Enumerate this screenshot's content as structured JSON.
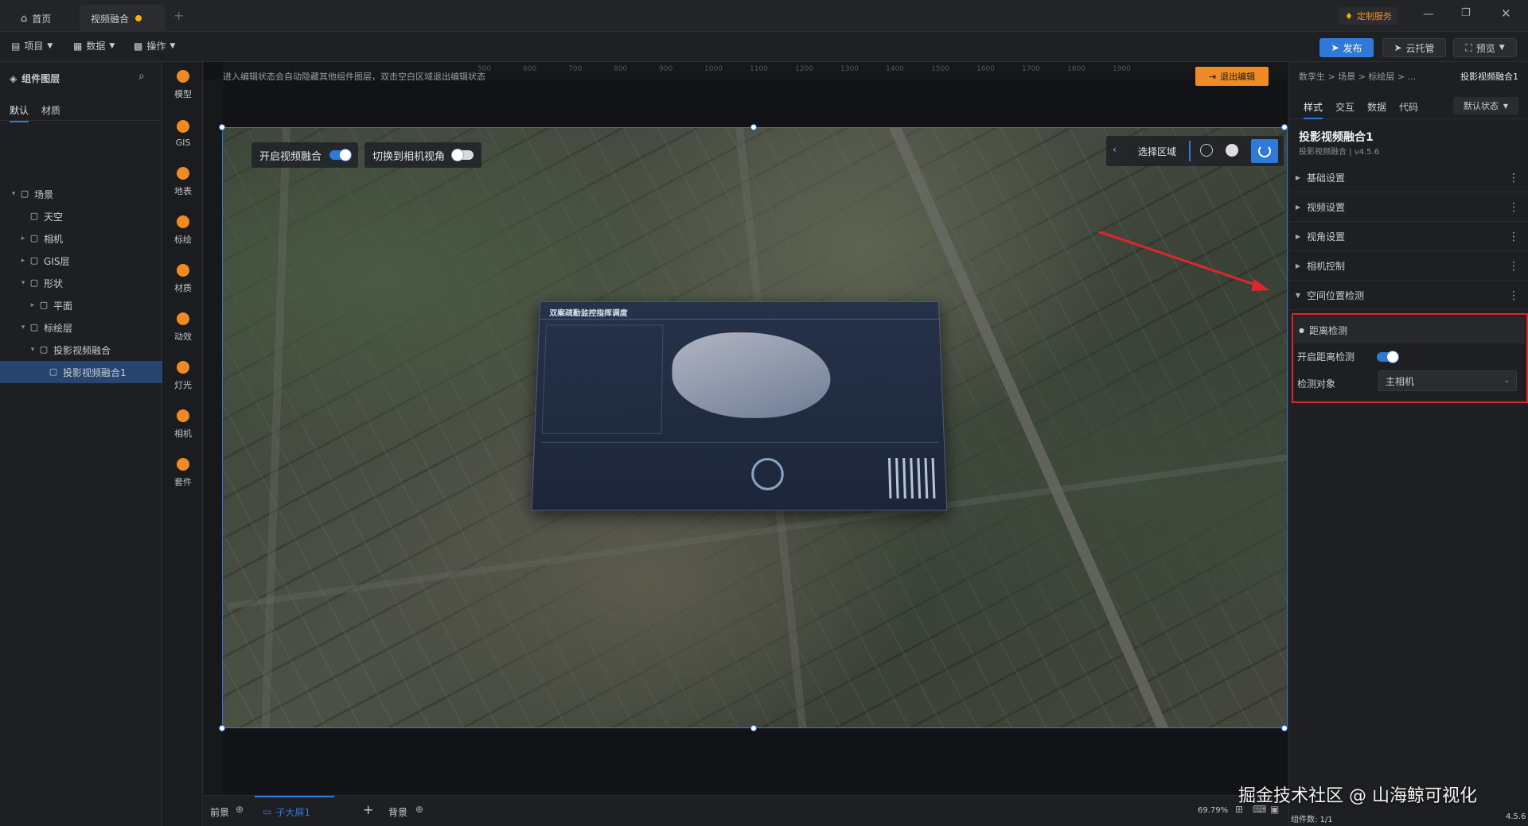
{
  "titlebar": {
    "home_tab": "首页",
    "active_tab": "视频融合",
    "service_badge": "定制服务"
  },
  "menubar": {
    "project": "项目",
    "data": "数据",
    "operate": "操作",
    "publish": "发布",
    "cloud": "云托管",
    "preview": "预览"
  },
  "left": {
    "title": "组件图层",
    "tabs": [
      "默认",
      "材质"
    ],
    "tree": [
      {
        "label": "场景",
        "icon": "scene-icon",
        "depth": 0,
        "expanded": true
      },
      {
        "label": "天空",
        "icon": "sky-icon",
        "depth": 1
      },
      {
        "label": "相机",
        "icon": "folder-icon",
        "depth": 1,
        "collapsed": true
      },
      {
        "label": "GIS层",
        "icon": "gis-icon",
        "depth": 1,
        "collapsed": true
      },
      {
        "label": "形状",
        "icon": "folder-icon",
        "depth": 1,
        "expanded": true
      },
      {
        "label": "平面",
        "icon": "plane-icon",
        "depth": 2,
        "collapsed": true
      },
      {
        "label": "标绘层",
        "icon": "folder-icon",
        "depth": 1,
        "expanded": true
      },
      {
        "label": "投影视频融合",
        "icon": "group-icon",
        "depth": 2,
        "expanded": true
      },
      {
        "label": "投影视频融合1",
        "icon": "group-icon",
        "depth": 3,
        "selected": true
      }
    ]
  },
  "tools": [
    "模型",
    "GIS",
    "地表",
    "标绘",
    "材质",
    "动效",
    "灯光",
    "相机",
    "套件"
  ],
  "canvas": {
    "hint": "进入编辑状态会自动隐藏其他组件图层，双击空白区域退出编辑状态",
    "exit_edit": "退出编辑",
    "toggle_video": "开启视频融合",
    "toggle_camera": "切换到相机视角",
    "select_area": "选择区域",
    "ruler_ticks": [
      "500",
      "600",
      "700",
      "800",
      "900",
      "1000",
      "1100",
      "1200",
      "1300",
      "1400",
      "1500",
      "1600",
      "1700",
      "1800",
      "1900"
    ],
    "dashboard_title": "双案疏勤监控指挥调度"
  },
  "right": {
    "breadcrumb": "数孪生 > 场景 > 标绘层 > ...",
    "component": "投影视频融合1",
    "tabs": [
      "样式",
      "交互",
      "数据",
      "代码"
    ],
    "state": "默认状态",
    "title": "投影视频融合1",
    "subtitle": "投影视频融合 | v4.5.6",
    "sections": [
      "基础设置",
      "视频设置",
      "视角设置",
      "相机控制",
      "空间位置检测"
    ],
    "sub_section": "距离检测",
    "enable_label": "开启距离检测",
    "target_label": "检测对象",
    "target_value": "主相机"
  },
  "bottom": {
    "front": "前景",
    "layer": "子大屏1",
    "back": "背景",
    "zoom": "69.79%",
    "count": "组件数: 1/1",
    "version": "4.5.6",
    "watermark": "掘金技术社区 @ 山海鲸可视化"
  },
  "colors": {
    "accent": "#2f7ad8",
    "warning": "#e0262d",
    "orange": "#f08a24"
  }
}
